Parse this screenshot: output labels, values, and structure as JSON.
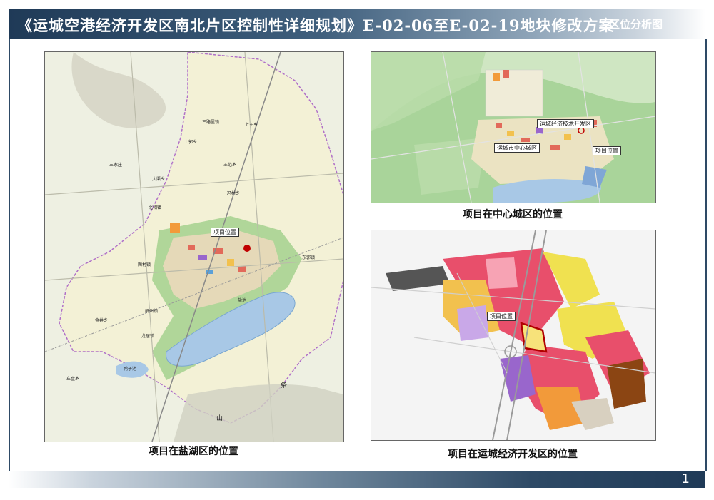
{
  "header": {
    "title": "《运城空港经济开发区南北片区控制性详细规划》E-02-06至E-02-19地块修改方案",
    "tag": "区位分析图"
  },
  "map_left": {
    "caption": "项目在盐湖区的位置",
    "callout": "项目位置",
    "labels": [
      "三路里镇",
      "上王乡",
      "上郭乡",
      "三家庄",
      "北相镇",
      "王范乡",
      "大渠乡",
      "冯村乡",
      "东郭镇",
      "陶村镇",
      "解州镇",
      "金井乡",
      "龙居镇",
      "车盘乡",
      "盐池",
      "鸭子池",
      "条",
      "山"
    ]
  },
  "map_top_right": {
    "caption": "项目在中心城区的位置",
    "callouts": [
      "运城经济技术开发区",
      "运城市中心城区",
      "项目位置"
    ]
  },
  "map_bottom_right": {
    "caption": "项目在运城经济开发区的位置",
    "callout": "项目位置"
  },
  "footer": {
    "page_number": "1"
  },
  "colors": {
    "title_bar": "#1f3a57",
    "project_marker": "#c00000",
    "boundary": "#b070c8"
  }
}
